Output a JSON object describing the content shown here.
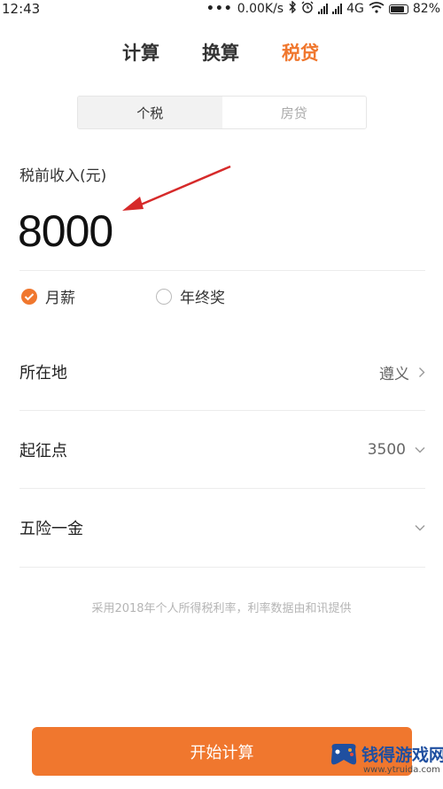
{
  "status_bar": {
    "time": "12:43",
    "network_speed": "0.00K/s",
    "network_type": "4G",
    "battery": "82%",
    "icons": [
      "more-dots-icon",
      "bluetooth-icon",
      "alarm-icon",
      "signal-icon",
      "signal-icon",
      "wifi-icon",
      "battery-icon"
    ]
  },
  "top_tabs": [
    {
      "label": "计算",
      "active": false
    },
    {
      "label": "换算",
      "active": false
    },
    {
      "label": "税贷",
      "active": true
    }
  ],
  "segment": [
    {
      "label": "个税",
      "active": true
    },
    {
      "label": "房贷",
      "active": false
    }
  ],
  "income": {
    "label": "税前收入(元)",
    "value": "8000"
  },
  "income_type": [
    {
      "label": "月薪",
      "selected": true
    },
    {
      "label": "年终奖",
      "selected": false
    }
  ],
  "rows": [
    {
      "label": "所在地",
      "value": "遵义",
      "icon": "chevron-right-icon"
    },
    {
      "label": "起征点",
      "value": "3500",
      "icon": "chevron-down-icon"
    },
    {
      "label": "五险一金",
      "value": "",
      "icon": "chevron-down-icon"
    }
  ],
  "footnote": "采用2018年个人所得税利率，利率数据由和讯提供",
  "start_button": "开始计算",
  "watermark": {
    "title": "钱得游戏网",
    "url": "www.ytruida.com"
  },
  "colors": {
    "accent": "#f0772e",
    "annotation_arrow": "#d62a2a",
    "watermark_blue": "#1f4fa0"
  }
}
